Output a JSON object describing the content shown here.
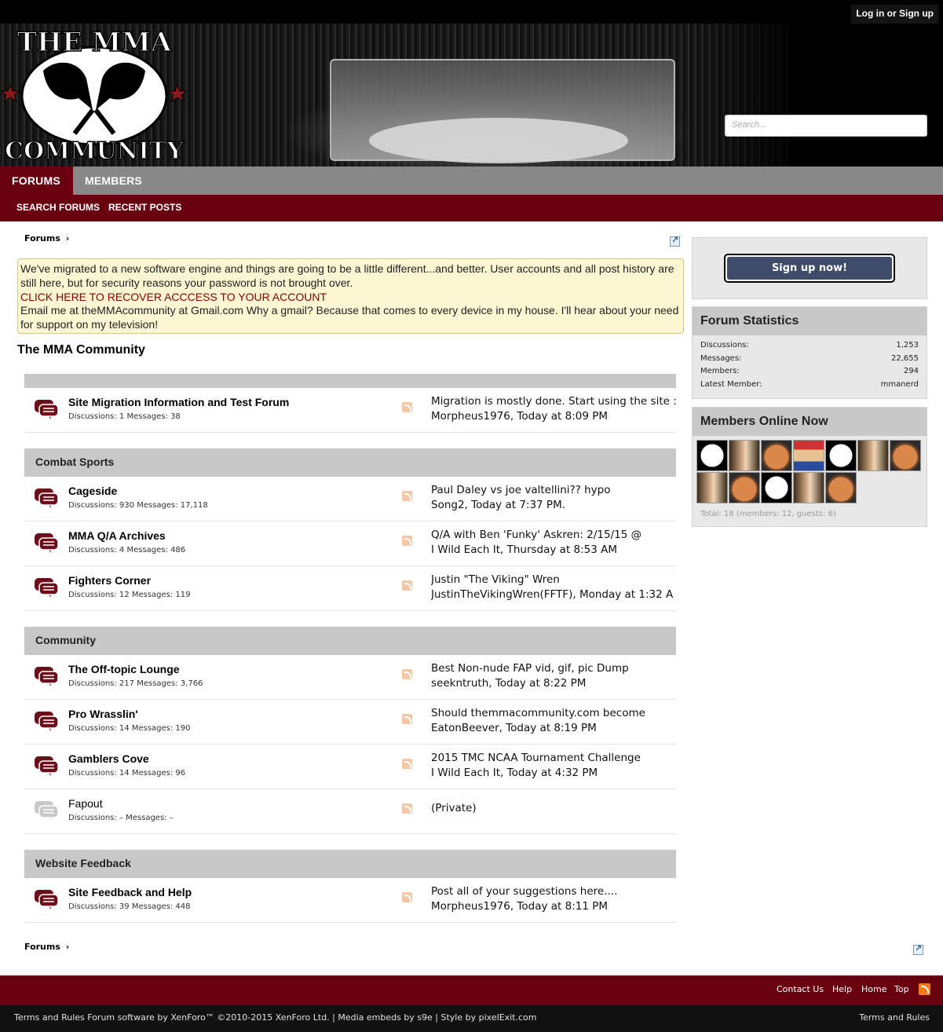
{
  "topbar": {
    "login_label": "Log in or Sign up"
  },
  "header": {
    "logo_text_top": "THE MMA",
    "logo_text_bottom": "COMMUNITY",
    "search_placeholder": "Search..."
  },
  "nav": {
    "tabs": [
      {
        "label": "FORUMS",
        "active": true
      },
      {
        "label": "MEMBERS",
        "active": false
      }
    ],
    "sub": [
      {
        "label": "SEARCH FORUMS"
      },
      {
        "label": "RECENT POSTS"
      }
    ]
  },
  "breadcrumb": {
    "label": "Forums",
    "sep": "›"
  },
  "notice": {
    "line1": "We've migrated to a new software engine and things are going to be a little different...and better. User accounts and all post history are still here, but for security reasons your password is not brought over.",
    "link": "CLICK HERE TO RECOVER ACCCESS TO YOUR ACCOUNT",
    "line2": "Email me at theMMAcommunity at Gmail.com Why a gmail? Because that comes to every device in my house. I'll hear about your need for support on my television!"
  },
  "main": {
    "title": "The MMA Community",
    "categories": [
      {
        "name": "",
        "forums": [
          {
            "name": "Site Migration Information and Test Forum",
            "stats": "Discussions: 1 Messages: 38",
            "last_title": "Migration is mostly done. Start using the site :)",
            "last_by": "Morpheus1976, Today at 8:09 PM"
          }
        ]
      },
      {
        "name": "Combat Sports",
        "forums": [
          {
            "name": "Cageside",
            "stats": "Discussions: 930 Messages: 17,118",
            "last_title": "Paul Daley vs joe valtellini?? hypo",
            "last_by": "Song2, Today at 7:37 PM."
          },
          {
            "name": "MMA Q/A Archives",
            "stats": "Discussions: 4 Messages: 486",
            "last_title": "Q/A with Ben 'Funky' Askren: 2/15/15 @",
            "last_by": "I Wild Each It, Thursday at 8:53 AM"
          },
          {
            "name": "Fighters Corner",
            "stats": "Discussions: 12 Messages: 119",
            "last_title": "Justin \"The Viking\" Wren",
            "last_by": "JustinTheVikingWren(FFTF), Monday at 1:32 A"
          }
        ]
      },
      {
        "name": "Community",
        "forums": [
          {
            "name": "The Off-topic Lounge",
            "stats": "Discussions: 217 Messages: 3,766",
            "last_title": "Best Non-nude FAP vid, gif, pic Dump",
            "last_by": "seekntruth, Today at 8:22 PM"
          },
          {
            "name": "Pro Wrasslin'",
            "stats": "Discussions: 14 Messages: 190",
            "last_title": "Should themmacommunity.com become",
            "last_by": "EatonBeever, Today at 8:19 PM"
          },
          {
            "name": "Gamblers Cove",
            "stats": "Discussions: 14 Messages: 96",
            "last_title": "2015 TMC NCAA Tournament Challenge",
            "last_by": "I Wild Each It, Today at 4:32 PM"
          },
          {
            "name": "Fapout",
            "stats": "Discussions: – Messages: –",
            "last_title": "(Private)",
            "last_by": ""
          }
        ]
      },
      {
        "name": "Website Feedback",
        "forums": [
          {
            "name": "Site Feedback and Help",
            "stats": "Discussions: 39 Messages: 448",
            "last_title": "Post all of your suggestions here....",
            "last_by": "Morpheus1976, Today at 8:11 PM"
          }
        ]
      }
    ]
  },
  "sidebar": {
    "signup_label": "Sign up now!",
    "stats": {
      "title": "Forum Statistics",
      "rows": [
        {
          "label": "Discussions:",
          "value": "1,253"
        },
        {
          "label": "Messages:",
          "value": "22,655"
        },
        {
          "label": "Members:",
          "value": "294"
        },
        {
          "label": "Latest Member:",
          "value": "mmanerd"
        }
      ]
    },
    "online": {
      "title": "Members Online Now",
      "total": "Total: 18 (members: 12, guests: 6)"
    }
  },
  "footer": {
    "links": [
      {
        "label": "Contact Us"
      },
      {
        "label": "Help"
      },
      {
        "label": "Home"
      },
      {
        "label": "Top"
      }
    ],
    "copyright": "Terms and Rules Forum software by XenForo™ ©2010-2015 XenForo Ltd. | Media embeds by s9e | Style by pixelExit.com",
    "terms": "Terms and Rules"
  },
  "colors": {
    "brand": "#690010",
    "nav_gray": "#888888",
    "notice_bg": "#fcf6d3",
    "icon_maroon": "#6b0f1a"
  }
}
